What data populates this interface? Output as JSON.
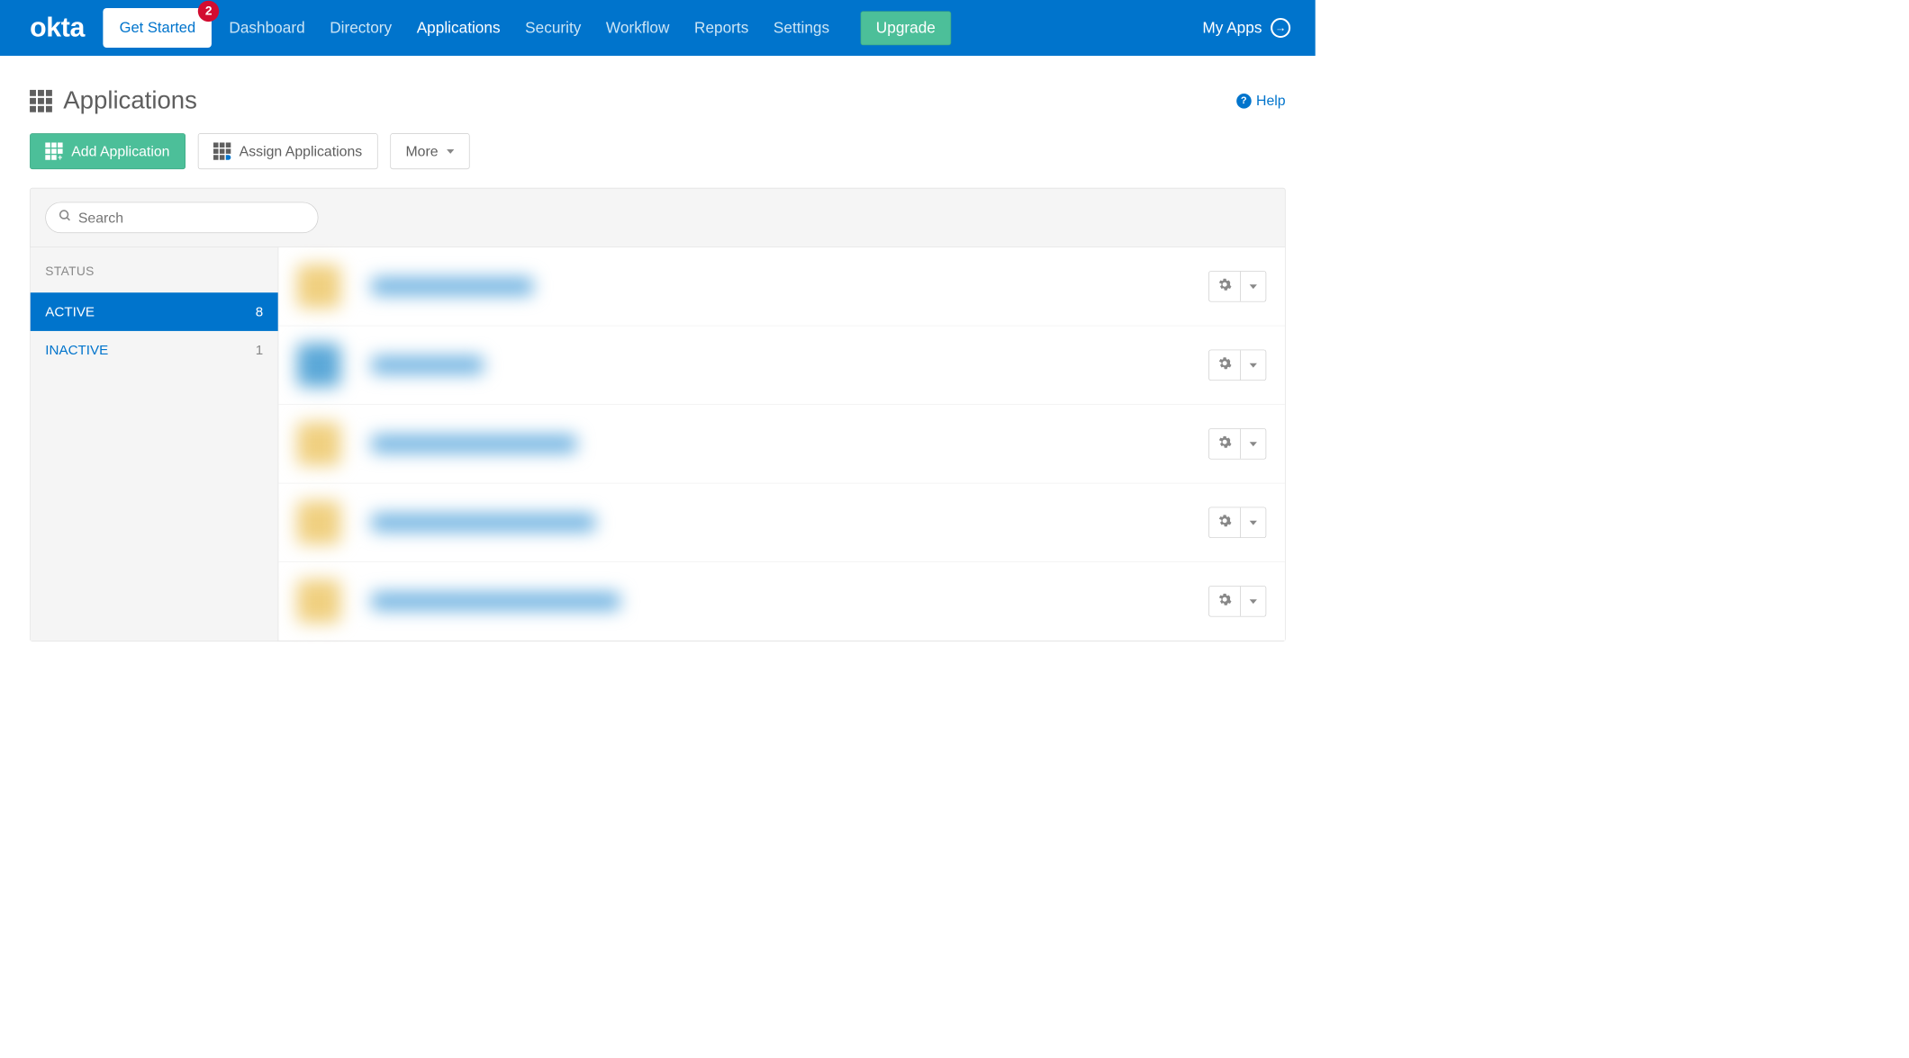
{
  "logo": "okta",
  "navbar": {
    "get_started": "Get Started",
    "badge_count": "2",
    "items": [
      {
        "label": "Dashboard",
        "active": false
      },
      {
        "label": "Directory",
        "active": false
      },
      {
        "label": "Applications",
        "active": true
      },
      {
        "label": "Security",
        "active": false
      },
      {
        "label": "Workflow",
        "active": false
      },
      {
        "label": "Reports",
        "active": false
      },
      {
        "label": "Settings",
        "active": false
      }
    ],
    "upgrade": "Upgrade",
    "my_apps": "My Apps"
  },
  "page": {
    "title": "Applications",
    "help": "Help"
  },
  "actions": {
    "add_application": "Add Application",
    "assign_applications": "Assign Applications",
    "more": "More"
  },
  "search": {
    "placeholder": "Search"
  },
  "sidebar": {
    "title": "STATUS",
    "items": [
      {
        "label": "ACTIVE",
        "count": "8",
        "selected": true
      },
      {
        "label": "INACTIVE",
        "count": "1",
        "selected": false
      }
    ]
  },
  "app_rows": 5
}
